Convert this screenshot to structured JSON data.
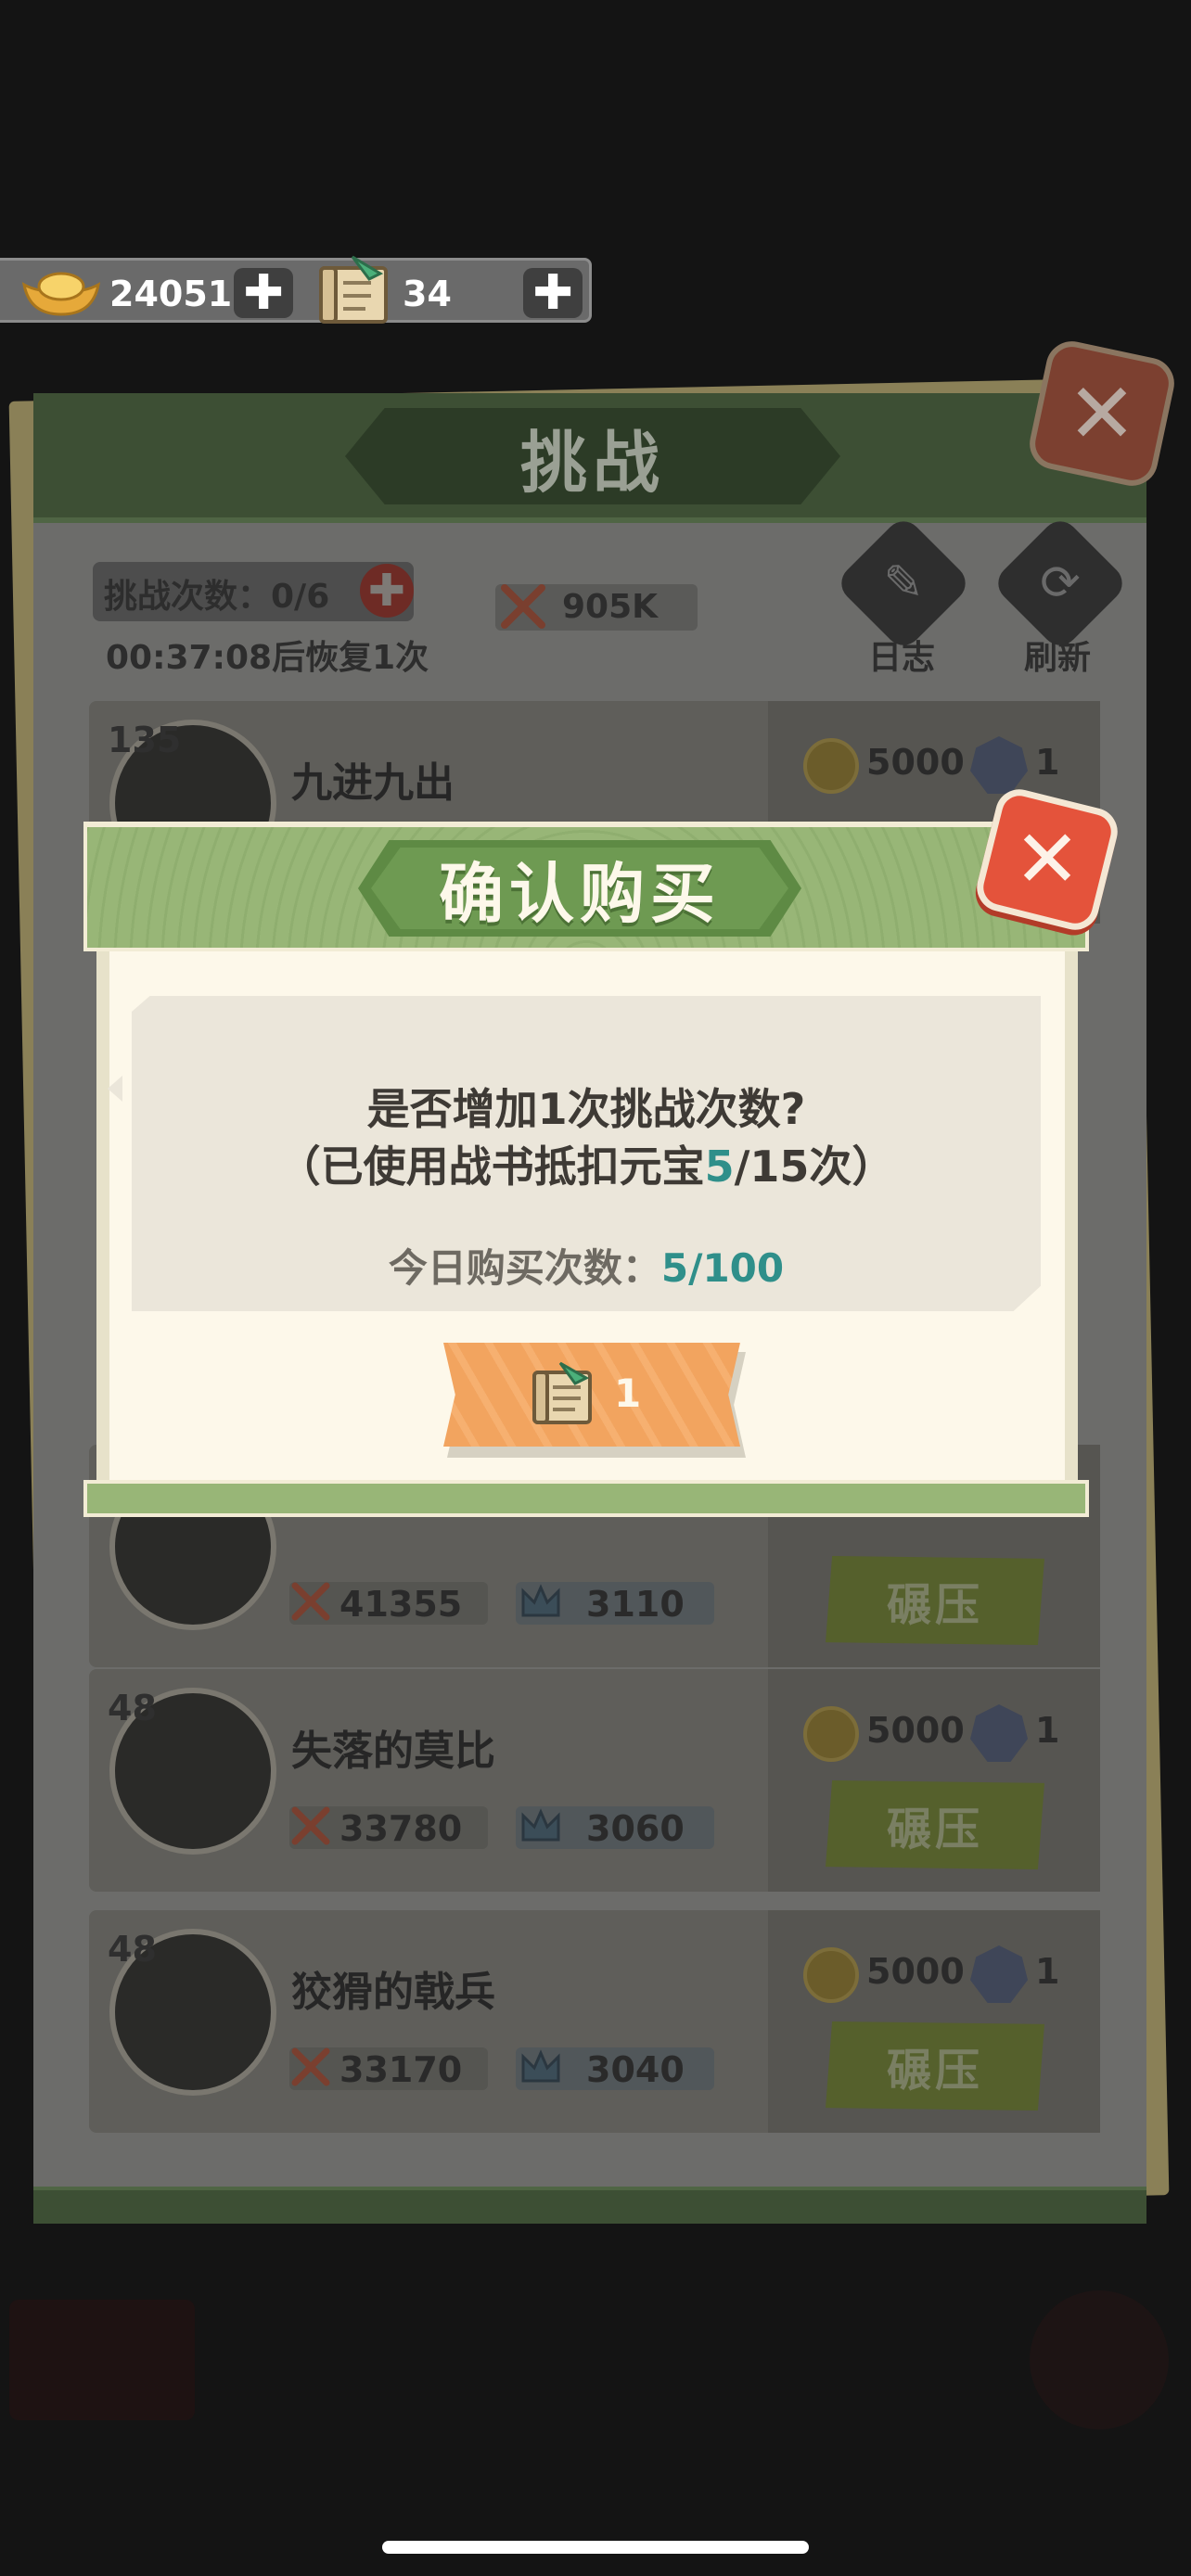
{
  "currency": {
    "gold_value": "24051",
    "war_book_value": "34",
    "add_symbol": "✚"
  },
  "panel": {
    "title": "挑战",
    "close_symbol": "✕",
    "attempts_label": "挑战次数：0/6",
    "add_symbol": "✚",
    "recover_text": "00:37:08后恢复1次",
    "power_value": "905K",
    "log_label": "日志",
    "refresh_label": "刷新",
    "log_glyph": "✎",
    "refresh_glyph": "⟳"
  },
  "opponents": [
    {
      "level": "135",
      "name": "九进九出",
      "reward_coins": "5000",
      "reward_tokens": "1"
    },
    {
      "power": "41355",
      "cups": "3110",
      "action": "碾压"
    },
    {
      "level": "48",
      "name": "失落的莫比",
      "power": "33780",
      "cups": "3060",
      "reward_coins": "5000",
      "reward_tokens": "1",
      "action": "碾压"
    },
    {
      "level": "48",
      "name": "狡猾的戟兵",
      "power": "33170",
      "cups": "3040",
      "reward_coins": "5000",
      "reward_tokens": "1",
      "action": "碾压"
    }
  ],
  "dialog": {
    "title": "确认购买",
    "close_symbol": "✕",
    "question": "是否增加1次挑战次数?",
    "sub_prefix": "（已使用战书抵扣元宝",
    "sub_used": "5",
    "sub_suffix": "/15次）",
    "daily_label": "今日购买次数：",
    "daily_value": "5/100",
    "cost_value": "1"
  },
  "colors": {
    "dialog_header_green": "#98b677",
    "highlight_teal": "#2f8f8a",
    "buy_button_orange": "#f2a45f",
    "close_red": "#e4533b"
  },
  "icons": {
    "gold": "gold-ingot-icon",
    "book": "war-book-scroll-icon",
    "power": "crossed-swords-icon",
    "cups": "crown-icon",
    "coin": "coin-icon",
    "token": "token-badge-icon"
  }
}
